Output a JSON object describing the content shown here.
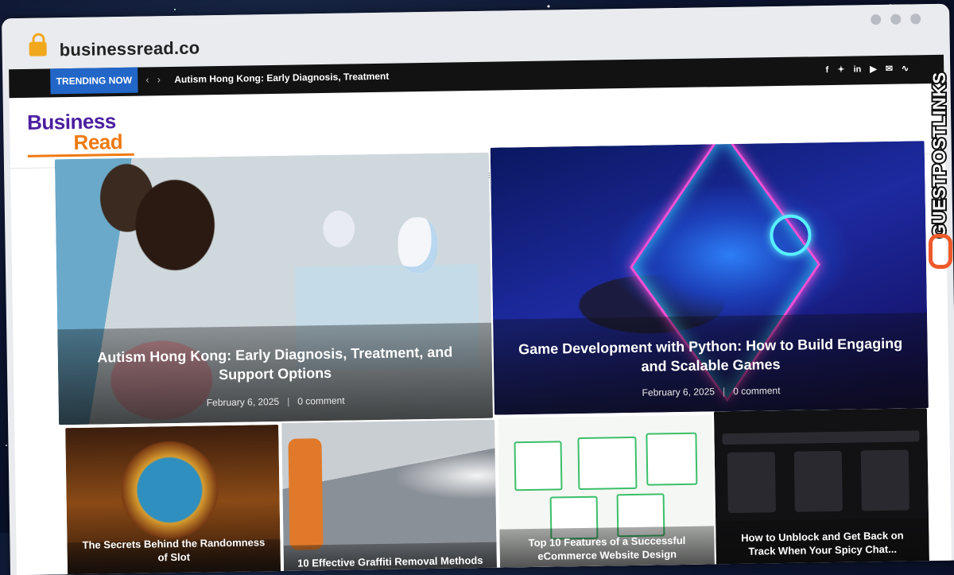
{
  "browser": {
    "url": "businessread.co"
  },
  "topbar": {
    "trending_label": "TRENDING NOW",
    "ticker": "Autism Hong Kong: Early Diagnosis, Treatment",
    "social_icons": [
      "facebook-icon",
      "twitter-icon",
      "linkedin-icon",
      "youtube-icon",
      "mail-icon",
      "rss-icon"
    ]
  },
  "logo": {
    "line1": "Business",
    "line2": "Read"
  },
  "featured": [
    {
      "title": "Autism Hong Kong: Early Diagnosis, Treatment, and Support Options",
      "date": "February 6, 2025",
      "comments": "0 comment"
    },
    {
      "title": "Game Development with Python: How to Build Engaging and Scalable Games",
      "date": "February 6, 2025",
      "comments": "0 comment"
    }
  ],
  "grid": [
    {
      "title": "The Secrets Behind the Randomness of Slot"
    },
    {
      "title": "10 Effective Graffiti Removal Methods"
    },
    {
      "title": "Top 10 Features of a Successful eCommerce Website Design"
    },
    {
      "title": "How to Unblock and Get Back on Track When Your Spicy Chat..."
    }
  ],
  "watermark": {
    "text": "GUESTPOSTLINKS"
  },
  "colors": {
    "accent": "#2266c8",
    "logo_purple": "#4b1fa0",
    "logo_orange": "#f07a12",
    "topbar": "#121212"
  }
}
